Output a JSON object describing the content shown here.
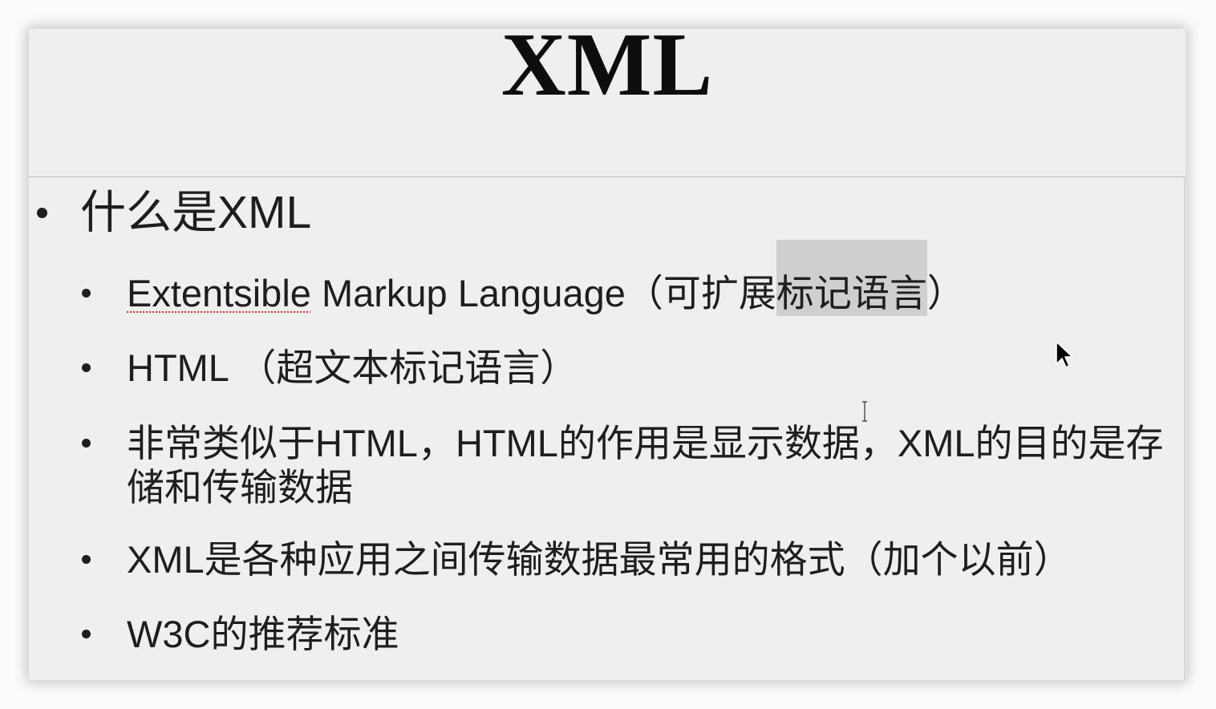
{
  "slide": {
    "title": "XML",
    "bullet": {
      "text": "什么是XML",
      "sub_items": [
        {
          "segments": {
            "misspelled": "Extentsible",
            "plain": " Markup Language（可扩展",
            "selected": "标记语言",
            "after": "）"
          }
        },
        {
          "text": "HTML （超文本标记语言）"
        },
        {
          "text": "非常类似于HTML，HTML的作用是显示数据，XML的目的是存储和传输数据"
        },
        {
          "text": "XML是各种应用之间传输数据最常用的格式（加个以前）"
        },
        {
          "text": "W3C的推荐标准"
        }
      ]
    }
  },
  "colors": {
    "background": "#efefef",
    "text": "#1e1e1e",
    "selection": "#cfcfcf",
    "spellcheck_underline": "#d9302c"
  },
  "icons": {
    "mouse_pointer": "arrow-cursor-icon",
    "text_cursor": "i-beam-cursor-icon"
  }
}
